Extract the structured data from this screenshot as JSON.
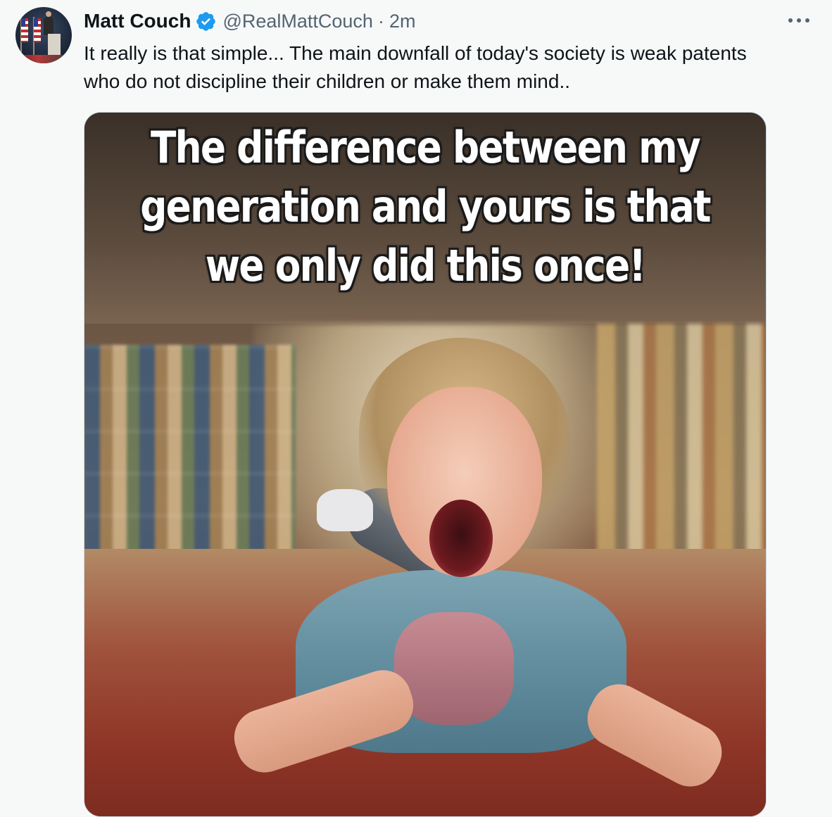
{
  "tweet": {
    "author": {
      "display_name": "Matt Couch",
      "handle": "@RealMattCouch",
      "verified_icon": "verified-badge-icon"
    },
    "separator": "·",
    "time": "2m",
    "more_icon": "more-options-icon",
    "text": "It really is that simple... The main downfall of today's society is weak patents who do not discipline their children or make them mind..",
    "media": {
      "caption_lines": [
        "The difference between my",
        "generation and yours is that",
        "we only did this once!"
      ]
    }
  },
  "colors": {
    "verified_blue": "#1d9bf0",
    "text_primary": "#0f1419",
    "text_secondary": "#536471",
    "background": "#f7f9f9"
  }
}
